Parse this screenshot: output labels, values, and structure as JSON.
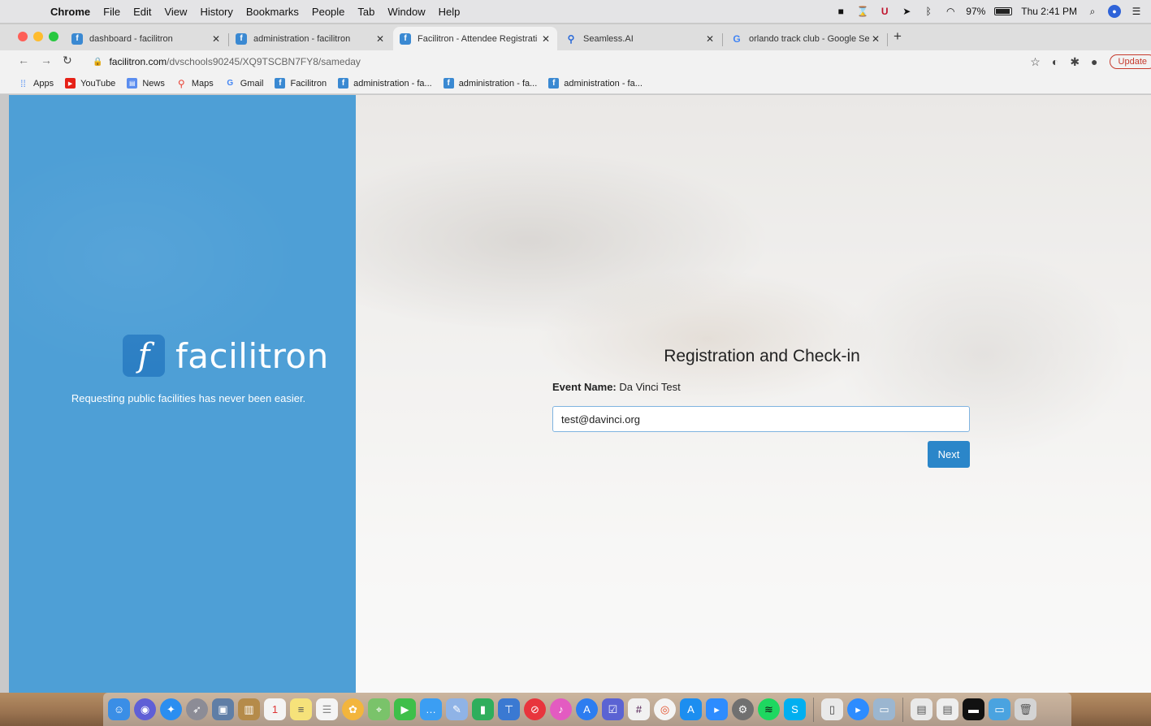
{
  "menubar": {
    "app_name": "Chrome",
    "items": [
      "File",
      "Edit",
      "View",
      "History",
      "Bookmarks",
      "People",
      "Tab",
      "Window",
      "Help"
    ],
    "battery": "97%",
    "clock": "Thu 2:41 PM"
  },
  "tabs": [
    {
      "title": "dashboard - facilitron",
      "icon": "facilitron-icon"
    },
    {
      "title": "administration - facilitron",
      "icon": "facilitron-icon"
    },
    {
      "title": "Facilitron - Attendee Registrati",
      "icon": "facilitron-icon",
      "active": true
    },
    {
      "title": "Seamless.AI",
      "icon": "seamless-icon"
    },
    {
      "title": "orlando track club - Google Se",
      "icon": "google-icon"
    }
  ],
  "address": {
    "domain": "facilitron.com",
    "path": "/dvschools90245/XQ9TSCBN7FY8/sameday",
    "update_label": "Update"
  },
  "bookmarks": [
    "Apps",
    "YouTube",
    "News",
    "Maps",
    "Gmail",
    "Facilitron",
    "administration - fa...",
    "administration - fa...",
    "administration - fa..."
  ],
  "brand": {
    "name": "facilitron",
    "tagline": "Requesting public facilities has never been easier."
  },
  "form": {
    "title": "Registration and Check-in",
    "event_label": "Event Name:",
    "event_name": "Da Vinci Test",
    "email_value": "test@davinci.org",
    "next_label": "Next"
  },
  "colors": {
    "brand_blue": "#4e9fd6",
    "button_blue": "#2b86c9"
  }
}
